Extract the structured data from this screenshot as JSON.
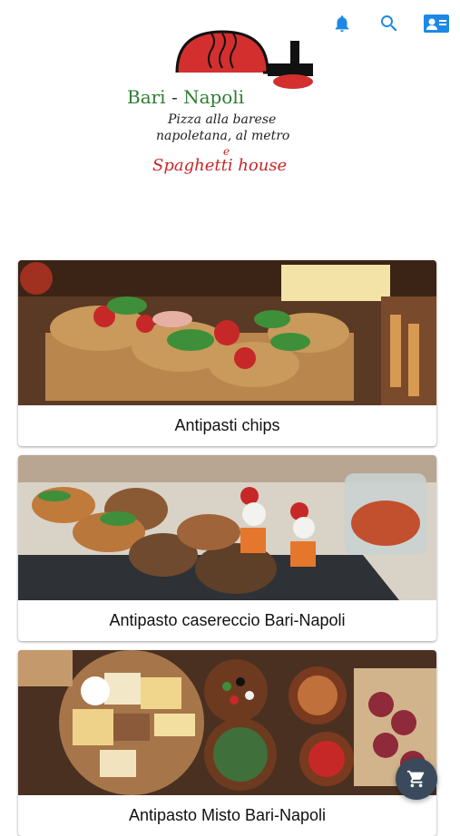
{
  "header": {
    "icons": [
      "bell-icon",
      "search-icon",
      "contact-card-icon"
    ],
    "accent_color": "#1e88e5"
  },
  "logo": {
    "title_left": "Bari",
    "title_dash": "-",
    "title_right": "Napoli",
    "line1": "Pizza alla barese",
    "line2": "napoletana, al metro",
    "line3": "e",
    "line4": "Spaghetti house"
  },
  "menu": {
    "items": [
      {
        "label": "Antipasti chips"
      },
      {
        "label": "Antipasto casereccio Bari-Napoli"
      },
      {
        "label": "Antipasto Misto Bari-Napoli"
      }
    ]
  },
  "cart": {
    "icon": "cart-icon"
  }
}
